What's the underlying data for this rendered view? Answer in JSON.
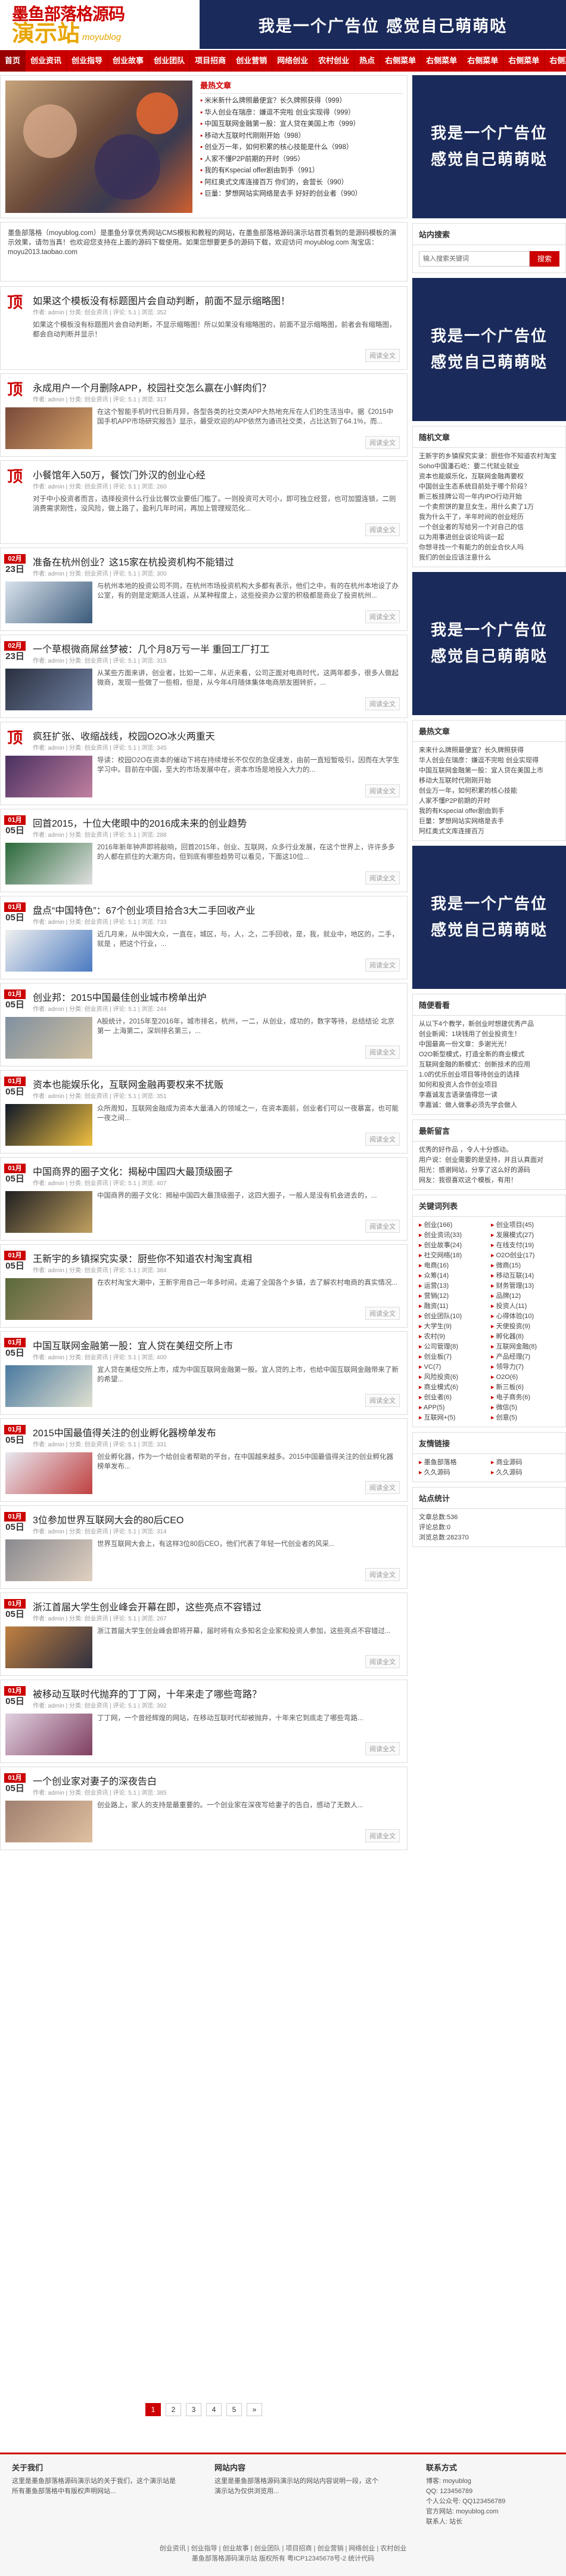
{
  "logo": {
    "top": "墨鱼部落格源码",
    "big": "演示站",
    "small": "moyublog"
  },
  "header_ad": "我是一个广告位    感觉自己萌萌哒",
  "nav": [
    "首页",
    "创业资讯",
    "创业指导",
    "创业故事",
    "创业团队",
    "项目招商",
    "创业营销",
    "网络创业",
    "农村创业",
    "热点"
  ],
  "nav_right": [
    "右侧菜单",
    "右侧菜单",
    "右侧菜单",
    "右侧菜单",
    "右侧菜单"
  ],
  "hot": {
    "title": "最热文章",
    "items": [
      "米米新什么牌照最便宜？长久牌照获得（999）",
      "华人创业在瑞彦：嫌逗不完啦 创业实现得（999）",
      "中国互联网金融第一股：宜人贷在美国上市（999）",
      "移动大互联时代刚刚开始（998）",
      "创业万一年，如何积累的核心技能是什么（998）",
      "人家不懂P2P前期的开时（995）",
      "我的有Kspecial offer剧由到手（991）",
      "阿红奥式文库连接百万 你们的，会营长（990）",
      "巨量：梦想网站实网络是去手 好好的创业者（990）"
    ]
  },
  "notice": "墨鱼部落格（moyublog.com）是墨鱼分享优秀网站CMS模板和教程的网站，在墨鱼部落格源码演示站首页看到的是源码模板的演示效果，请勿当真！也欢迎您支持在上面的源码下载使用。如果您想要更多的源码下载，欢迎访问 moyublog.com 淘宝店：moyu2013.taobao.com",
  "posts": [
    {
      "month": "",
      "day": "",
      "title": "如果这个模板没有标题图片会自动判断，前面不显示缩略图！",
      "meta": "作者: admin | 分类: 创业资讯 | 评论: 5.1 | 浏览: 352",
      "desc": "如果这个模板没有标题图片会自动判断，不显示缩略图！所以如果没有缩略图的，前面不显示缩略图，前者会有缩略图，都会自动判断并显示！",
      "more": "阅读全文"
    },
    {
      "month": "",
      "day": "",
      "title": "永成用户一个月删除APP，校园社交怎么赢在小鲜肉们？",
      "meta": "作者: admin | 分类: 创业资讯 | 评论: 5.1 | 浏览: 317",
      "desc": "在这个智能手机时代日新月异，各型各类的社交类APP大热地充斥在人们的生活当中。据《2015中国手机APP市场研究报告》显示，最受欢迎的APP依然为通讯社交类，占比达到了64.1%，而...",
      "more": "阅读全文"
    },
    {
      "month": "",
      "day": "",
      "title": "小餐馆年入50万，餐饮门外汉的创业心经",
      "meta": "作者: admin | 分类: 创业资讯 | 评论: 5.1 | 浏览: 260",
      "desc": "对于中小投资者而言，选择投资什么行业比餐饮业要低门槛了。一则投资可大可小，即可独立经营，也可加盟连锁，二则消费需求刚性，没风险，做上路了，盈利几年时间，再加上管理规范化...",
      "more": "阅读全文"
    },
    {
      "month": "02月",
      "day": "23日",
      "title": "准备在杭州创业？这15家在杭投资机构不能错过",
      "meta": "作者: admin | 分类: 创业资讯 | 评论: 5.1 | 浏览: 300",
      "desc": "与杭州本地的投资公司不同，在杭州市场投资机构大多都有表示，他们之中，有的在杭州本地设了办公室，有的则是定期派人往返，从某种程度上，这些投资办公室的积极都是商业了投资杭州...",
      "more": "阅读全文"
    },
    {
      "month": "02月",
      "day": "23日",
      "title": "一个草根微商屌丝梦被：几个月8万亏一半 重回工厂打工",
      "meta": "作者: admin | 分类: 创业资讯 | 评论: 5.1 | 浏览: 315",
      "desc": "从某些方面来讲，创业者，比如一二年，从近来看，公司正面对电商时代，这两年都多，很多人做起微商，发现一些做了一些相，但是，从今年4月随体集体电商朋友圈转折，...",
      "more": "阅读全文"
    },
    {
      "month": "",
      "day": "",
      "title": "疯狂扩张、收缩战线，校园O2O冰火两重天",
      "meta": "作者: admin | 分类: 创业资讯 | 评论: 5.1 | 浏览: 345",
      "desc": "导读：校园O2O在资本的催动下将在持续增长不仅仅的急促速发，由前一直短暂吸引，因而在大学生学习中。目前在中国，至大的市场发展中在，资本市场是地投入大力的...",
      "more": "阅读全文"
    },
    {
      "month": "01月",
      "day": "05日",
      "title": "回首2015，十位大佬眼中的2016成未来的创业趋势",
      "meta": "作者: admin | 分类: 创业资讯 | 评论: 5.1 | 浏览: 288",
      "desc": "2016年新年钟声即将敲响，回首2015年，创业、互联网，众多行业发展，在这个世界上，许许多多的人都在抓住的大潮方向，但到底有哪些趋势可以看见，下面这10位...",
      "more": "阅读全文"
    },
    {
      "month": "01月",
      "day": "05日",
      "title": "盘点“中国特色”：67个创业项目拾合3大二手回收产业",
      "meta": "作者: admin | 分类: 创业资讯 | 评论: 5.1 | 浏览: 733",
      "desc": "近几月来，从中国大众，一直在，城区，与，人，之，二手回收，是，我，就业中，地区的，二手，就是 ，把这个行业，...",
      "more": "阅读全文"
    },
    {
      "month": "01月",
      "day": "05日",
      "title": "创业邦：2015中国最佳创业城市榜单出炉",
      "meta": "作者: admin | 分类: 创业资讯 | 评论: 5.1 | 浏览: 244",
      "desc": "A股统计，2015年至2016年，城市排名，杭州，一二，从创业，成功的，数字等待，总结结论 北京第一 上海第二，深圳排名第三，...",
      "more": "阅读全文"
    },
    {
      "month": "01月",
      "day": "05日",
      "title": "资本也能娱乐化，互联网金融再要权来不扰贩",
      "meta": "作者: admin | 分类: 创业资讯 | 评论: 5.1 | 浏览: 351",
      "desc": "众所周知，互联网金融成为资本大量涌入的领域之一，在资本面前，创业者们可以一夜暴富，也可能一夜之间...",
      "more": "阅读全文"
    },
    {
      "month": "01月",
      "day": "05日",
      "title": "中国商界的圈子文化：揭秘中国四大最顶级圈子",
      "meta": "作者: admin | 分类: 创业资讯 | 评论: 5.1 | 浏览: 407",
      "desc": "中国商界的圈子文化：揭秘中国四大最顶级圈子，这四大圈子，一般人是没有机会进去的，...",
      "more": "阅读全文"
    },
    {
      "month": "01月",
      "day": "05日",
      "title": "王新宇的乡镇探究实录：厨些你不知道农村淘宝真相",
      "meta": "作者: admin | 分类: 创业资讯 | 评论: 5.1 | 浏览: 384",
      "desc": "在农村淘宝大潮中，王新宇用自己一年多时间，走遍了全国各个乡镇，去了解农村电商的真实情况...",
      "more": "阅读全文"
    },
    {
      "month": "01月",
      "day": "05日",
      "title": "中国互联网金融第一股：宜人贷在美纽交所上市",
      "meta": "作者: admin | 分类: 创业资讯 | 评论: 5.1 | 浏览: 400",
      "desc": "宜人贷在美纽交所上市，成为中国互联网金融第一股。宜人贷的上市，也给中国互联网金融带来了新的希望...",
      "more": "阅读全文"
    },
    {
      "month": "01月",
      "day": "05日",
      "title": "2015中国最值得关注的创业孵化器榜单发布",
      "meta": "作者: admin | 分类: 创业资讯 | 评论: 5.1 | 浏览: 331",
      "desc": "创业孵化器，作为一个给创业者帮助的平台，在中国越来越多。2015中国最值得关注的创业孵化器榜单发布...",
      "more": "阅读全文"
    },
    {
      "month": "01月",
      "day": "05日",
      "title": "3位参加世界互联网大会的80后CEO",
      "meta": "作者: admin | 分类: 创业资讯 | 评论: 5.1 | 浏览: 314",
      "desc": "世界互联网大会上，有这样3位80后CEO，他们代表了年轻一代创业者的风采...",
      "more": "阅读全文"
    },
    {
      "month": "01月",
      "day": "05日",
      "title": "浙江首届大学生创业峰会开幕在即，这些亮点不容错过",
      "meta": "作者: admin | 分类: 创业资讯 | 评论: 5.1 | 浏览: 267",
      "desc": "浙江首届大学生创业峰会即将开幕，届时将有众多知名企业家和投资人参加，这些亮点不容错过...",
      "more": "阅读全文"
    },
    {
      "month": "01月",
      "day": "05日",
      "title": "被移动互联时代抛弃的丁丁网，十年来走了哪些弯路？",
      "meta": "作者: admin | 分类: 创业资讯 | 评论: 5.1 | 浏览: 392",
      "desc": "丁丁网，一个曾经辉煌的网站，在移动互联时代却被抛弃，十年来它到底走了哪些弯路...",
      "more": "阅读全文"
    },
    {
      "month": "01月",
      "day": "05日",
      "title": "一个创业家对妻子的深夜告白",
      "meta": "作者: admin | 分类: 创业资讯 | 评论: 5.1 | 浏览: 385",
      "desc": "创业路上，家人的支持是最重要的。一个创业家在深夜写给妻子的告白，感动了无数人...",
      "more": "阅读全文"
    }
  ],
  "pager": [
    "1",
    "2",
    "3",
    "4",
    "5",
    "»"
  ],
  "side_ad": [
    "我是一个广告位",
    "感觉自己萌萌哒"
  ],
  "search": {
    "title": "站内搜索",
    "placeholder": "输入搜索关键词",
    "button": "搜索"
  },
  "random": {
    "title": "随机文章",
    "items": [
      "王新宇的乡镇探究实录：厨些你不知道农村淘宝",
      "Soho中国潘石屹：要二代就业就业",
      "资本也能娱乐化，互联网金融再要权",
      "中国创业生态系统目前处于哪个阶段？",
      "新三板挂牌公司一年内IPO行动开始",
      "一个卖煎饼的复旦女生，用什么卖了1万",
      "我为什么干了，半年时间的创业经历",
      "一个创业者的写给另一个对自己的信",
      "以为用事进创业谈论吗谈一起",
      "你想寻找一个有能力的创业合伙人吗",
      "我们的创业应该注意什么"
    ]
  },
  "latest": {
    "title": "最热文章",
    "items": [
      "来来什么牌照最便宜？长久牌照获得",
      "华人创业在瑞彦：嫌逗不完啦 创业实现得",
      "中国互联网金融第一股：宜人贷在美国上市",
      "移动大互联时代刚刚开始",
      "创业万一年，如何积累的核心技能",
      "人家不懂P2P前期的开时",
      "我的有Kspecial offer剧由到手",
      "巨量：梦想网站实网络是去手",
      "阿红奥式文库连接百万"
    ]
  },
  "comments": {
    "title": "随便看看",
    "items": [
      "从以下4个教学，新创业时想建优秀产品",
      "创业新闻：1块钱用了创业投资生！",
      "中国最高一份文章：多谢光光！",
      "O2O新型模式，打造全新的商业模式",
      "互联网金融的新模式：创新技术的应用",
      "1.0的优乐创业项目等待创业的选择",
      "如何和投资人合作创业项目",
      "李嘉诚发言语录值得您一读",
      "李嘉诚：做人做事必须先学会做人"
    ]
  },
  "recent_comments": {
    "title": "最新留言",
    "items": [
      "优秀的好作品 ，令人十分感动。",
      "用户说：创业需要的是坚持，并且认真面对",
      "阳光：感谢网站，分享了这么好的源码",
      "网友：我很喜欢这个模板，有用！"
    ]
  },
  "tags": {
    "title": "关键词列表",
    "items": [
      "创业(166)",
      "创业项目(45)",
      "创业资讯(33)",
      "发展模式(27)",
      "创业故事(24)",
      "在线支付(19)",
      "社交网络(18)",
      "O2O创业(17)",
      "电商(16)",
      "微商(15)",
      "众筹(14)",
      "移动互联(14)",
      "运营(13)",
      "财务管理(13)",
      "营销(12)",
      "品牌(12)",
      "融资(11)",
      "投资人(11)",
      "创业团队(10)",
      "心得体验(10)",
      "大学生(9)",
      "天使投资(9)",
      "农村(9)",
      "孵化器(8)",
      "公司管理(8)",
      "互联网金融(8)",
      "创业板(7)",
      "产品经理(7)",
      "VC(7)",
      "领导力(7)",
      "风险投资(6)",
      "O2O(6)",
      "商业模式(6)",
      "新三板(6)",
      "创业者(6)",
      "电子商务(6)",
      "APP(5)",
      "微信(5)",
      "互联网+(5)",
      "创意(5)"
    ]
  },
  "links": {
    "title": "友情链接",
    "items": [
      "墨鱼部落格",
      "商业源码",
      "久久源码",
      "久久源码"
    ]
  },
  "stats": {
    "title": "站点统计",
    "items": [
      "文章总数:536",
      "评论总数:0",
      "浏览总数:282370"
    ]
  },
  "footer": {
    "about_title": "关于我们",
    "about_text": "这里是墨鱼部落格源码演示站的关于我们，这个演示站是所有墨鱼部落格中有版权声明网站...",
    "links_title": "网站内容",
    "links_text": "这里是墨鱼部落格源码演示站的网站内容说明一段，这个演示站为仅供浏览用...",
    "contact_title": "联系方式",
    "contact_items": [
      "博客: moyublog",
      "QQ: 123456789",
      "个人公众号: QQ123456789",
      "官方网站: moyublog.com",
      "联系人: 站长"
    ],
    "nav": "创业资讯 | 创业指导 | 创业故事 | 创业团队 | 项目招商 | 创业营销 | 网络创业 | 农村创业",
    "copyright": "墨鱼部落格源码演示站 版权所有 粤ICP12345678号-2 统计代码"
  }
}
